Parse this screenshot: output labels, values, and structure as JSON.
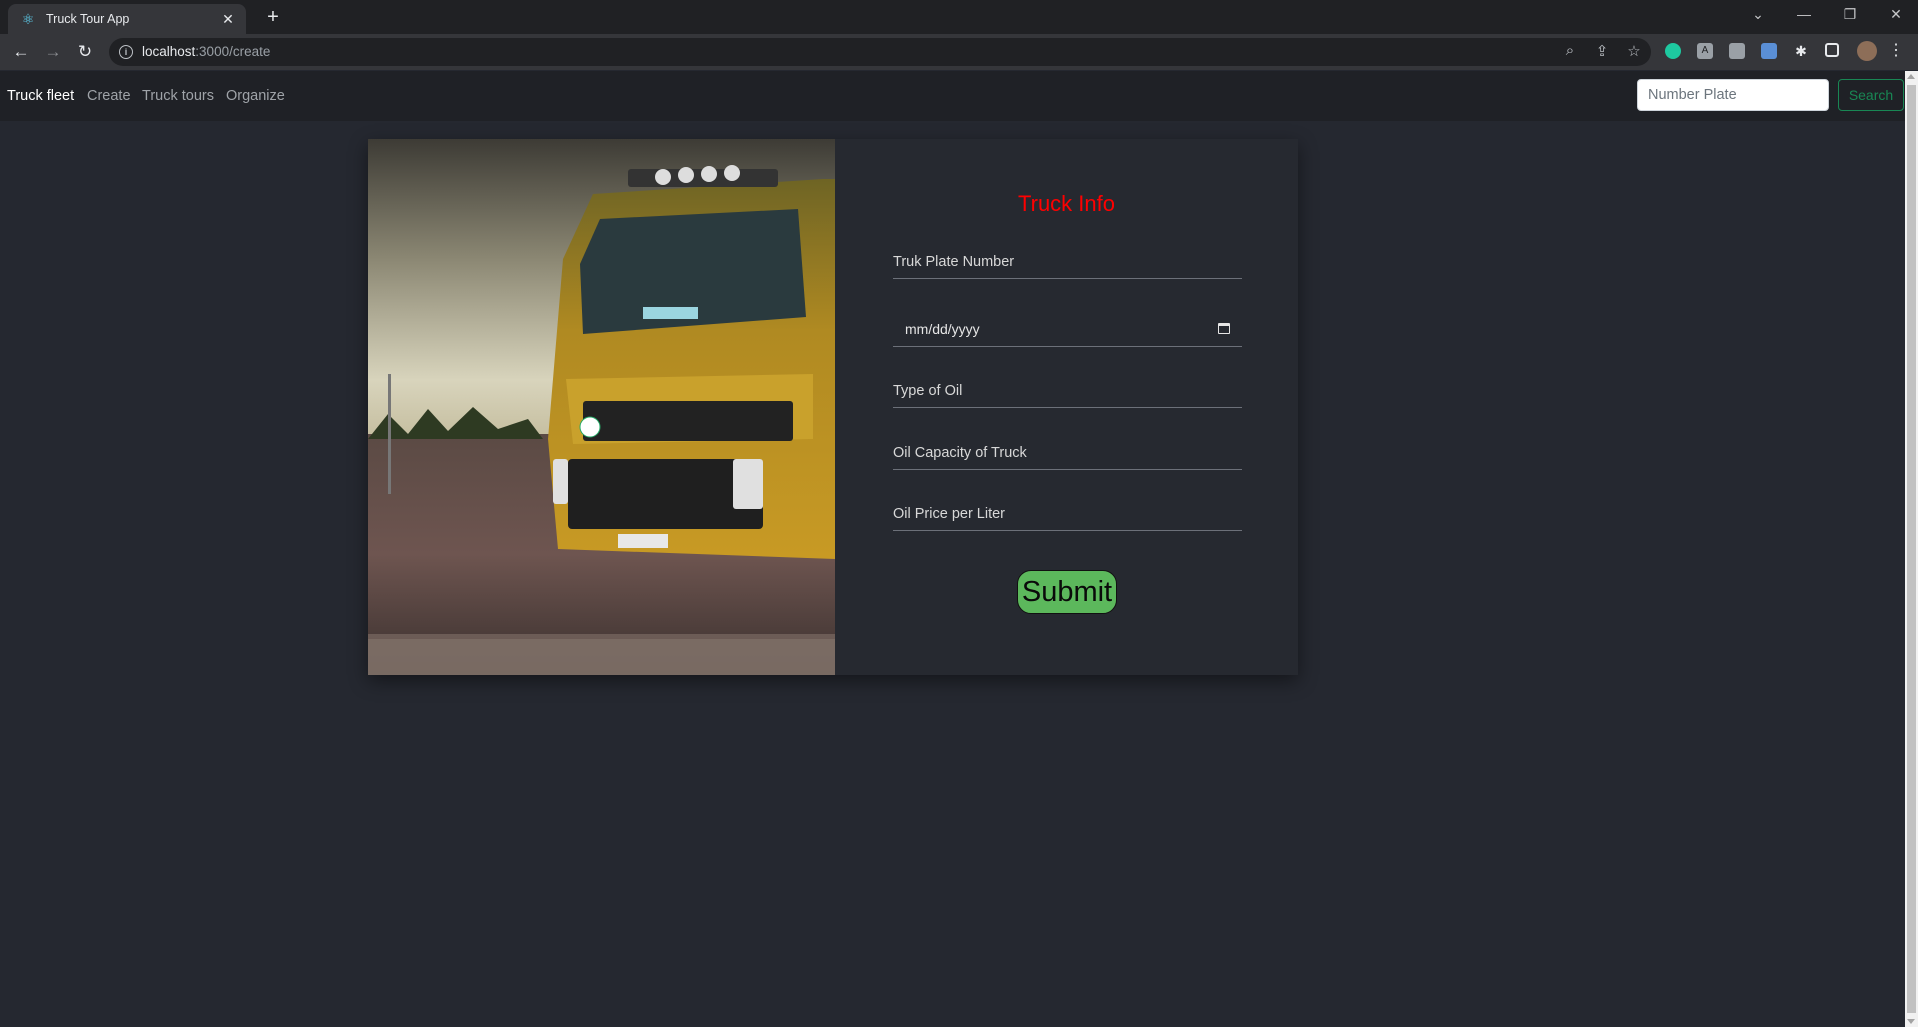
{
  "browser": {
    "tab_title": "Truck Tour App",
    "url_host": "localhost",
    "url_path": ":3000/create"
  },
  "navbar": {
    "brand": "Truck fleet",
    "links": [
      "Create",
      "Truck tours",
      "Organize"
    ],
    "search_placeholder": "Number Plate",
    "search_label": "Search"
  },
  "form": {
    "title": "Truck Info",
    "plate_placeholder": "Truk Plate Number",
    "date_placeholder": "mm/dd/yyyy",
    "oil_type_placeholder": "Type of Oil",
    "oil_capacity_placeholder": "Oil Capacity of Truck",
    "oil_price_placeholder": "Oil Price per Liter",
    "submit_label": "Submit"
  },
  "colors": {
    "page_bg": "#252830",
    "title": "#ff0000",
    "submit_bg": "#5cb85c",
    "search_btn": "#198754"
  }
}
